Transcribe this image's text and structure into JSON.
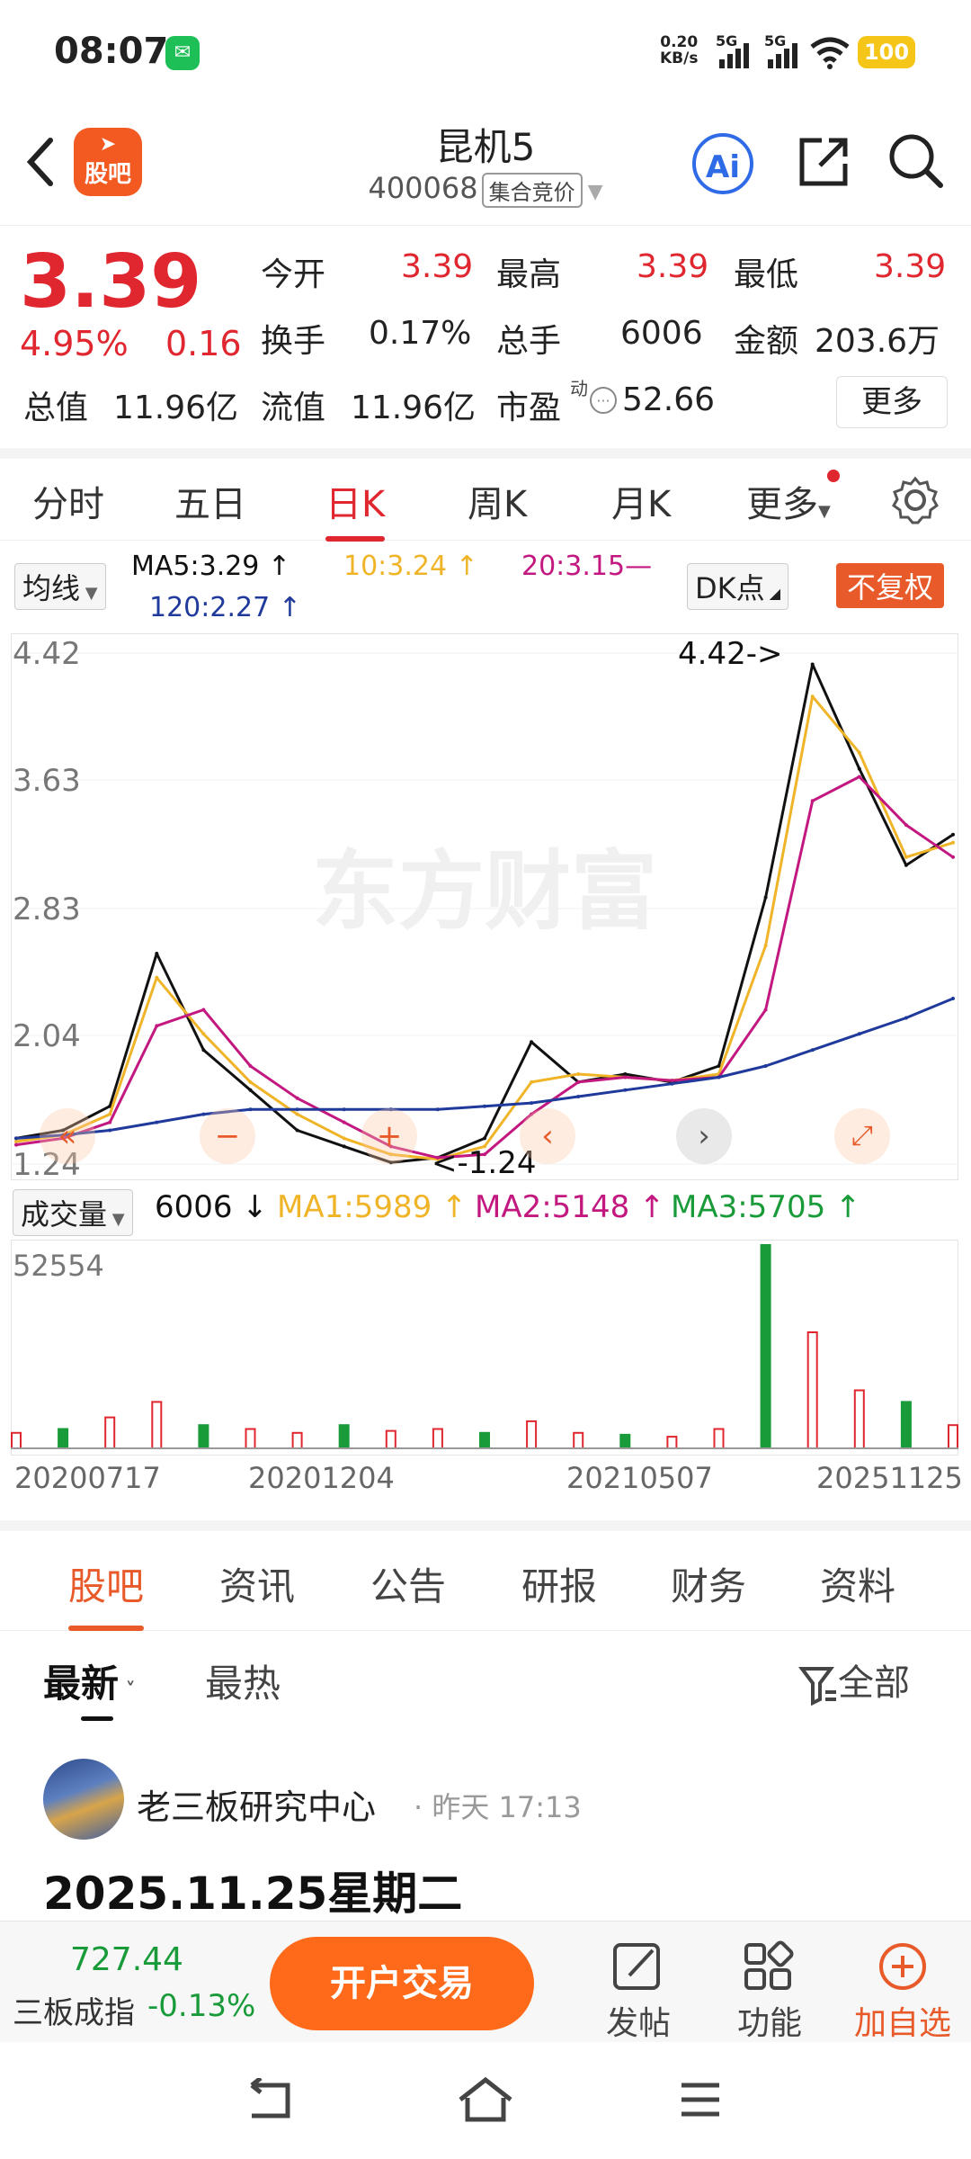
{
  "status_bar": {
    "time": "08:07",
    "net_speed_value": "0.20",
    "net_speed_unit": "KB/s",
    "signal_label_1": "5G",
    "signal_label_2": "5G",
    "battery": "100"
  },
  "header": {
    "app_badge": "股吧",
    "stock_name": "昆机5",
    "stock_code": "400068",
    "market_tag": "集合竞价",
    "ai_label": "Ai"
  },
  "quote": {
    "price": "3.39",
    "change_pct": "4.95%",
    "change": "0.16",
    "open_label": "今开",
    "open_value": "3.39",
    "high_label": "最高",
    "high_value": "3.39",
    "low_label": "最低",
    "low_value": "3.39",
    "turnover_label": "换手",
    "turnover_value": "0.17%",
    "volume_label": "总手",
    "volume_value": "6006",
    "amount_label": "金额",
    "amount_value": "203.6万",
    "mktcap_label": "总值",
    "mktcap_value": "11.96亿",
    "float_label": "流值",
    "float_value": "11.96亿",
    "pe_label": "市盈",
    "pe_sup": "动",
    "pe_value": "52.66",
    "more_button": "更多"
  },
  "kline_tabs": {
    "items": [
      "分时",
      "五日",
      "日K",
      "周K",
      "月K",
      "更多"
    ],
    "active_index": 2
  },
  "ma_legend": {
    "selector": "均线",
    "ma5": "MA5:3.29 ↑",
    "ma10": "10:3.24 ↑",
    "ma20": "20:3.15—",
    "ma120": "120:2.27 ↑",
    "dk_button": "DK点",
    "adjust_button": "不复权"
  },
  "colors": {
    "ma5": "#111111",
    "ma10": "#f0b429",
    "ma20": "#c2187f",
    "ma120": "#1f3a9b",
    "up": "#e0262e",
    "down": "#1a9b3a",
    "accent": "#ff6a1a"
  },
  "chart_data": [
    {
      "type": "line",
      "title": "",
      "y_ticks": [
        "4.42",
        "3.63",
        "2.83",
        "2.04",
        "1.24"
      ],
      "ylim": [
        1.24,
        4.42
      ],
      "annotations": [
        "4.42->",
        "<-1.24"
      ],
      "watermark": "东方财富",
      "x": [
        0,
        5,
        10,
        15,
        20,
        25,
        30,
        35,
        40,
        45,
        50,
        55,
        60,
        65,
        70,
        75,
        80,
        85,
        90,
        95,
        100
      ],
      "series": [
        {
          "name": "MA5",
          "values": [
            1.4,
            1.45,
            1.6,
            2.55,
            1.95,
            1.7,
            1.45,
            1.35,
            1.25,
            1.28,
            1.4,
            2.0,
            1.75,
            1.8,
            1.75,
            1.85,
            2.9,
            4.35,
            3.7,
            3.1,
            3.29
          ]
        },
        {
          "name": "10",
          "values": [
            1.38,
            1.42,
            1.55,
            2.4,
            2.05,
            1.75,
            1.55,
            1.4,
            1.3,
            1.27,
            1.35,
            1.75,
            1.8,
            1.78,
            1.76,
            1.8,
            2.6,
            4.15,
            3.8,
            3.15,
            3.24
          ]
        },
        {
          "name": "20",
          "values": [
            1.36,
            1.4,
            1.5,
            2.1,
            2.2,
            1.85,
            1.65,
            1.5,
            1.35,
            1.28,
            1.3,
            1.55,
            1.75,
            1.78,
            1.76,
            1.78,
            2.2,
            3.5,
            3.65,
            3.35,
            3.15
          ]
        },
        {
          "name": "120",
          "values": [
            1.4,
            1.42,
            1.45,
            1.5,
            1.55,
            1.58,
            1.58,
            1.58,
            1.58,
            1.58,
            1.6,
            1.62,
            1.66,
            1.7,
            1.74,
            1.78,
            1.85,
            1.95,
            2.05,
            2.15,
            2.27
          ]
        }
      ]
    },
    {
      "type": "bar",
      "title": "",
      "y_ticks": [
        "52554"
      ],
      "ylim": [
        0,
        52554
      ],
      "legend": {
        "selector": "成交量",
        "current": "6006 ↓",
        "ma1": "MA1:5989 ↑",
        "ma2": "MA2:5148 ↑",
        "ma3": "MA3:5705 ↑"
      },
      "x_ticks": [
        "20200717",
        "20201204",
        "20210507",
        "20251125"
      ],
      "x": [
        0,
        5,
        10,
        15,
        20,
        25,
        30,
        35,
        40,
        45,
        50,
        55,
        60,
        65,
        70,
        75,
        80,
        85,
        90,
        95,
        100
      ],
      "series": [
        {
          "name": "volume",
          "values": [
            4000,
            5000,
            8000,
            12000,
            6000,
            5000,
            4000,
            6000,
            4500,
            5000,
            4000,
            7000,
            4000,
            3500,
            3000,
            5000,
            52554,
            30000,
            15000,
            12000,
            6006
          ]
        }
      ]
    }
  ],
  "info_tabs": {
    "items": [
      "股吧",
      "资讯",
      "公告",
      "研报",
      "财务",
      "资料"
    ],
    "active_index": 0
  },
  "sort": {
    "latest": "最新",
    "hot": "最热",
    "filter": "全部"
  },
  "post": {
    "author": "老三板研究中心",
    "time": "昨天 17:13",
    "title": "2025.11.25星期二"
  },
  "bottom_bar": {
    "index_value": "727.44",
    "index_name": "三板成指",
    "index_change": "-0.13%",
    "open_trade": "开户交易",
    "post_btn": "发帖",
    "func_btn": "功能",
    "add_btn": "加自选"
  }
}
